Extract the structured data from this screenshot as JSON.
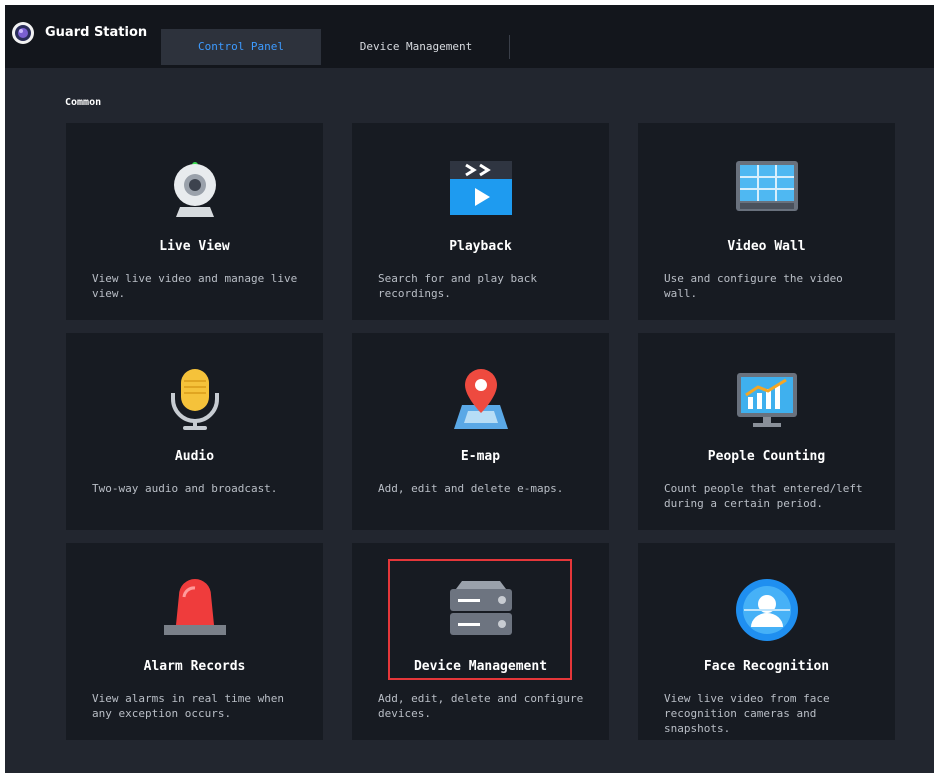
{
  "header": {
    "app_title": "Guard Station",
    "tabs": [
      {
        "label": "Control Panel",
        "active": true
      },
      {
        "label": "Device Management",
        "active": false
      }
    ]
  },
  "section": {
    "label": "Common"
  },
  "cards": [
    {
      "title": "Live View",
      "desc": "View live video and manage live view.",
      "icon": "webcam-icon"
    },
    {
      "title": "Playback",
      "desc": "Search for and play back recordings.",
      "icon": "playback-icon"
    },
    {
      "title": "Video Wall",
      "desc": "Use and configure the video wall.",
      "icon": "video-wall-icon"
    },
    {
      "title": "Audio",
      "desc": "Two-way audio and broadcast.",
      "icon": "microphone-icon"
    },
    {
      "title": "E-map",
      "desc": "Add, edit and delete e-maps.",
      "icon": "map-pin-icon"
    },
    {
      "title": "People Counting",
      "desc": "Count people that entered/left during a certain period.",
      "icon": "chart-monitor-icon"
    },
    {
      "title": "Alarm Records",
      "desc": "View alarms in real time when any exception occurs.",
      "icon": "alarm-light-icon"
    },
    {
      "title": "Device Management",
      "desc": "Add, edit, delete and configure devices.",
      "icon": "server-icon"
    },
    {
      "title": "Face Recognition",
      "desc": "View live video from face recognition cameras and snapshots.",
      "icon": "face-recognition-icon"
    }
  ],
  "colors": {
    "accent": "#3d9bff",
    "highlight": "#e5373a",
    "card_bg": "#171b22",
    "panel_bg": "#22262f"
  }
}
